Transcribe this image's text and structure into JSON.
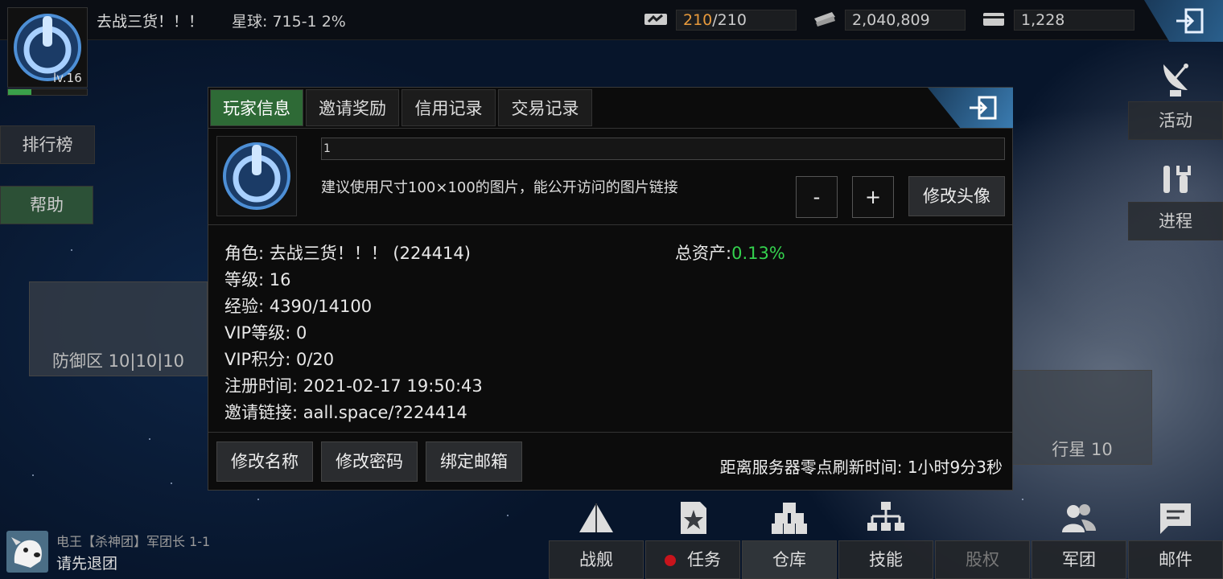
{
  "player": {
    "name": "去战三货！！！",
    "planet": "星球: 715-1  2%",
    "level": "lv.16",
    "level_progress": 0.3
  },
  "resources": [
    {
      "icon": "energy-icon",
      "current": "210",
      "max": "/210"
    },
    {
      "icon": "credits-icon",
      "value": "2,040,809"
    },
    {
      "icon": "card-icon",
      "value": "1,228"
    }
  ],
  "sidebar": {
    "rank": "排行榜",
    "help": "帮助",
    "activity": "活动",
    "progress": "进程"
  },
  "map": {
    "defense": "防御区 10|10|10",
    "planet": "行星 10"
  },
  "dialog": {
    "tabs": [
      "玩家信息",
      "邀请奖励",
      "信用记录",
      "交易记录"
    ],
    "avatar_url": "1",
    "hint": "建议使用尺寸100×100的图片，能公开访问的图片链接",
    "minus": "-",
    "plus": "+",
    "change_avatar": "修改头像",
    "info": [
      "角色: 去战三货！！！  (224414)",
      "等级: 16",
      "经验: 4390/14100",
      "VIP等级: 0",
      "VIP积分: 0/20",
      "注册时间: 2021-02-17 19:50:43",
      "邀请链接: aall.space/?224414"
    ],
    "total_label": "总资产:",
    "total_value": "0.13%",
    "buttons": [
      "修改名称",
      "修改密码",
      "绑定邮箱"
    ],
    "refresh": "距离服务器零点刷新时间: 1小时9分3秒"
  },
  "nav": [
    "战舰",
    "任务",
    "仓库",
    "技能",
    "股权",
    "军团",
    "邮件"
  ],
  "chat": {
    "line1": "电王【杀神团】军团长 1-1",
    "line2": "请先退团"
  },
  "colors": {
    "accent_green": "#2e6a36",
    "percent_green": "#34d24e",
    "energy_orange": "#e89a3c",
    "alert_red": "#c8141c"
  }
}
